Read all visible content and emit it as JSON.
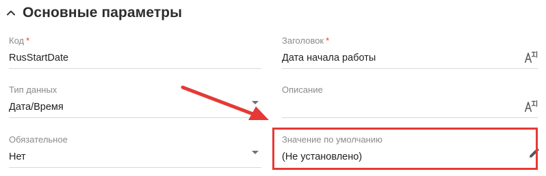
{
  "section": {
    "title": "Основные параметры"
  },
  "fields": {
    "code": {
      "label": "Код",
      "required_mark": "*",
      "value": "RusStartDate"
    },
    "title": {
      "label": "Заголовок",
      "required_mark": "*",
      "value": "Дата начала работы"
    },
    "data_type": {
      "label": "Тип данных",
      "value": "Дата/Время"
    },
    "description": {
      "label": "Описание",
      "value": ""
    },
    "required": {
      "label": "Обязательное",
      "value": "Нет"
    },
    "default_value": {
      "label": "Значение по умолчанию",
      "value": "(Не установлено)"
    }
  },
  "icons": {
    "collapse": "chevron-up-icon",
    "translate": "translate-icon",
    "edit": "pencil-icon",
    "dropdown": "caret-down-icon"
  },
  "colors": {
    "annotation": "#e53935",
    "required_marker": "#e53935",
    "label": "#8a8a8a",
    "icon": "#555555"
  }
}
